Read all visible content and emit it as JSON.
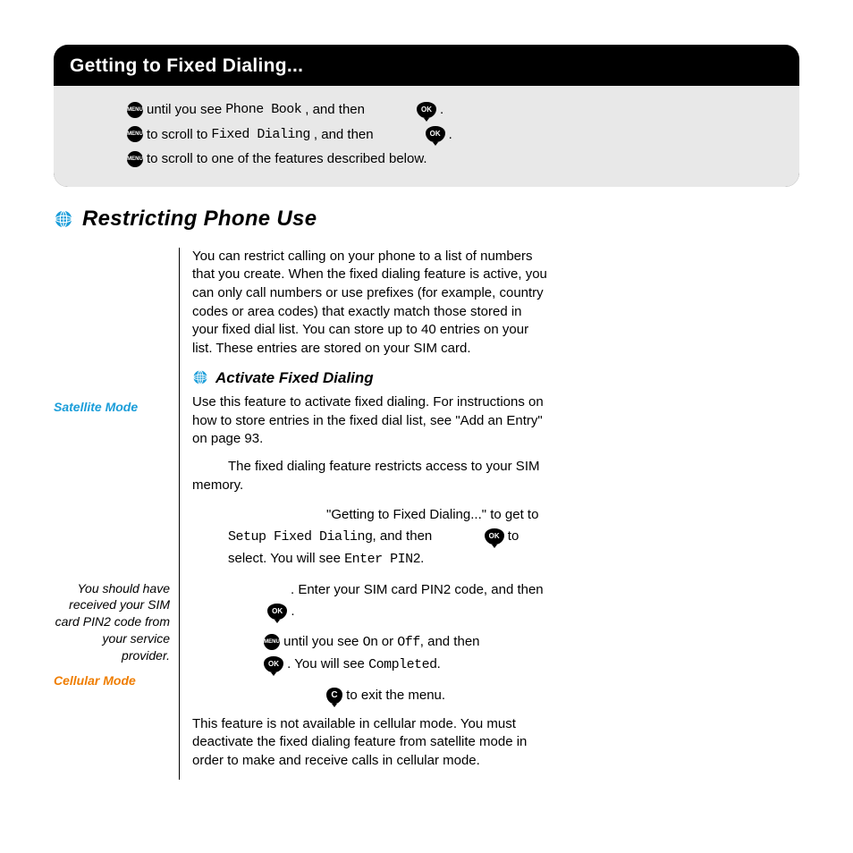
{
  "box": {
    "title": "Getting to Fixed Dialing...",
    "step1_a": "until you see ",
    "step1_b": "Phone Book",
    "step1_c": ", and then",
    "step1_d": ".",
    "step2_a": "to scroll to ",
    "step2_b": "Fixed Dialing",
    "step2_c": ", and then",
    "step2_d": ".",
    "step3": "to scroll to one of the features described below."
  },
  "h1": "Restricting Phone Use",
  "intro": "You can restrict calling on your phone to a list of numbers that you create. When the fixed dialing feature is active, you can only call numbers or use prefixes (for example, country codes or area codes) that exactly match those stored in your fixed dial list. You can store up to 40 entries on your list. These entries are stored on your SIM card.",
  "h2": "Activate Fixed Dialing",
  "sidebar": {
    "sat": "Satellite Mode",
    "pin_note": "You should have received your SIM card PIN2 code from your service provider.",
    "cell": "Cellular Mode"
  },
  "sat_p1": "Use this feature to activate fixed dialing. For instructions on how to store entries in the fixed dial list, see \"Add an Entry\" on page 93.",
  "sat_p2": "The fixed dialing feature restricts access to your SIM memory.",
  "steps": {
    "s1_a": "\"Getting to Fixed Dialing...\" to get to ",
    "s1_b": "Setup Fixed Dialing",
    "s1_c": ", and then",
    "s1_d": "to select. You will see ",
    "s1_e": "Enter PIN2",
    "s1_f": ".",
    "s2_a": ". Enter your SIM card PIN2 code, and then",
    "s2_b": ".",
    "s3_a": "until you see ",
    "s3_b": "On",
    "s3_c": " or ",
    "s3_d": "Off",
    "s3_e": ", and then",
    "s3_f": ". You will see ",
    "s3_g": "Completed",
    "s3_h": ".",
    "s4": "to exit the menu."
  },
  "cell_p": "This feature is not available in cellular mode. You must deactivate the fixed dialing feature from satellite mode in order to make and receive calls in cellular mode."
}
